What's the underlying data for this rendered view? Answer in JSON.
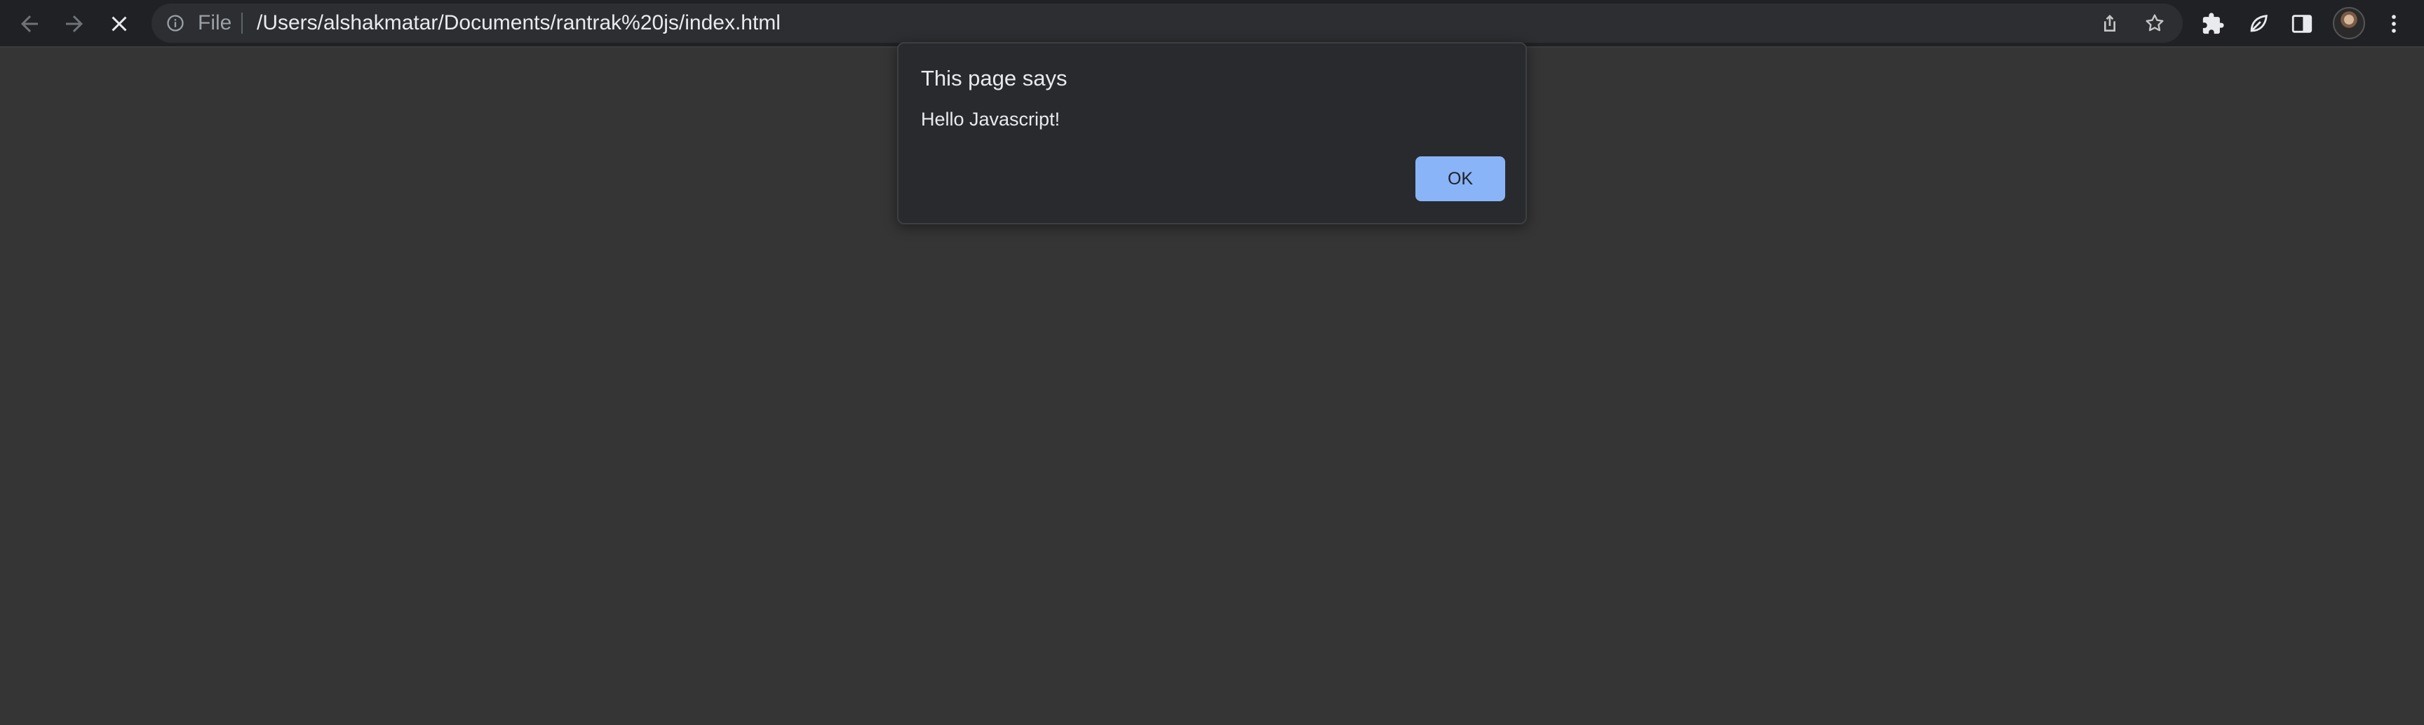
{
  "browser": {
    "nav": {
      "back_icon": "arrow-left-icon",
      "forward_icon": "arrow-right-icon",
      "stop_icon": "close-icon"
    },
    "omnibox": {
      "info_icon": "info-icon",
      "scheme_label": "File",
      "url": "/Users/alshakmatar/Documents/rantrak%20js/index.html",
      "share_icon": "share-icon",
      "bookmark_icon": "star-icon"
    },
    "toolbar_icons": [
      "puzzle-icon",
      "leaf-icon",
      "side-panel-icon",
      "avatar",
      "kebab-menu-icon"
    ]
  },
  "dialog": {
    "title": "This page says",
    "message": "Hello Javascript!",
    "ok_label": "OK"
  },
  "colors": {
    "page_background": "#353535",
    "toolbar_background": "#202124",
    "omnibox_background": "#2d2e31",
    "dialog_background": "#292a2d",
    "ok_button": "#8ab4f8"
  }
}
